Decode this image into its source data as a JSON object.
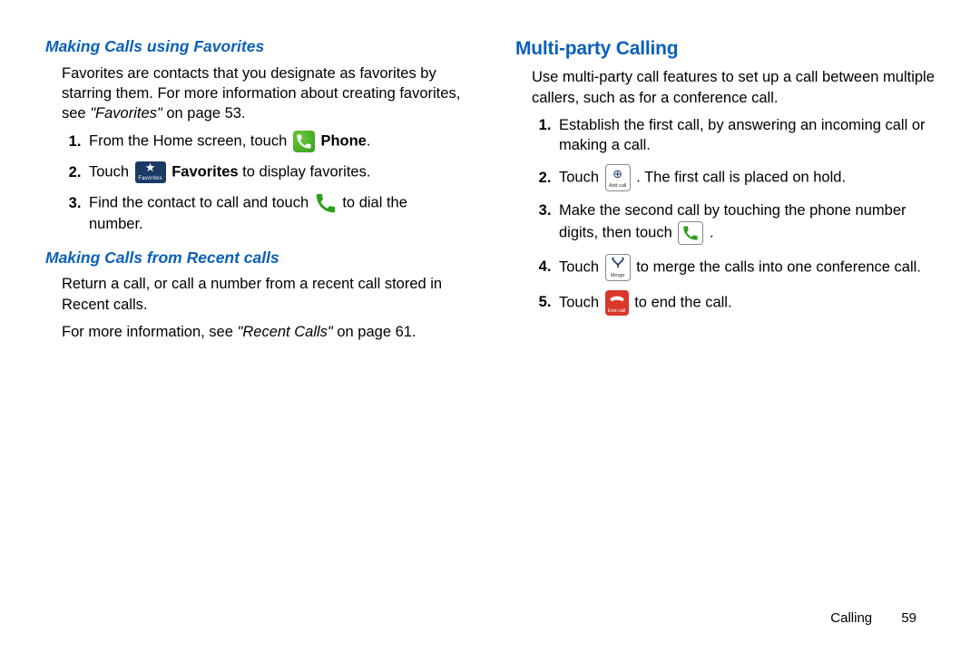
{
  "left": {
    "sectionA": {
      "heading": "Making Calls using Favorites",
      "intro_a": "Favorites are contacts that you designate as favorites by starring them. For more information about creating favorites, see ",
      "intro_ref": "\"Favorites\"",
      "intro_b": " on page 53.",
      "steps": {
        "s1a": "From the Home screen, touch ",
        "s1b": " Phone",
        "s1c": ".",
        "s2a": "Touch ",
        "s2b": " Favorites",
        "s2c": " to display favorites.",
        "s3a": "Find the contact to call and touch ",
        "s3b": " to dial the number."
      }
    },
    "sectionB": {
      "heading": "Making Calls from Recent calls",
      "p1": "Return a call, or call a number from a recent call stored in Recent calls.",
      "p2a": "For more information, see ",
      "p2ref": "\"Recent Calls\"",
      "p2b": " on page 61."
    }
  },
  "right": {
    "heading": "Multi-party Calling",
    "intro": "Use multi-party call features to set up a call between multiple callers, such as for a conference call.",
    "steps": {
      "s1": "Establish the first call, by answering an incoming call or making a call.",
      "s2a": "Touch ",
      "s2b": ". The first call is placed on hold.",
      "s3a": "Make the second call by touching the phone number digits, then touch ",
      "s3b": ".",
      "s4a": "Touch ",
      "s4b": " to merge the calls into one conference call.",
      "s5a": "Touch ",
      "s5b": " to end the call."
    }
  },
  "icons": {
    "favorites_label": "Favorites",
    "addcall_label": "Add call",
    "merge_label": "Merge",
    "endcall_label": "End call"
  },
  "footer": {
    "section": "Calling",
    "page": "59"
  }
}
